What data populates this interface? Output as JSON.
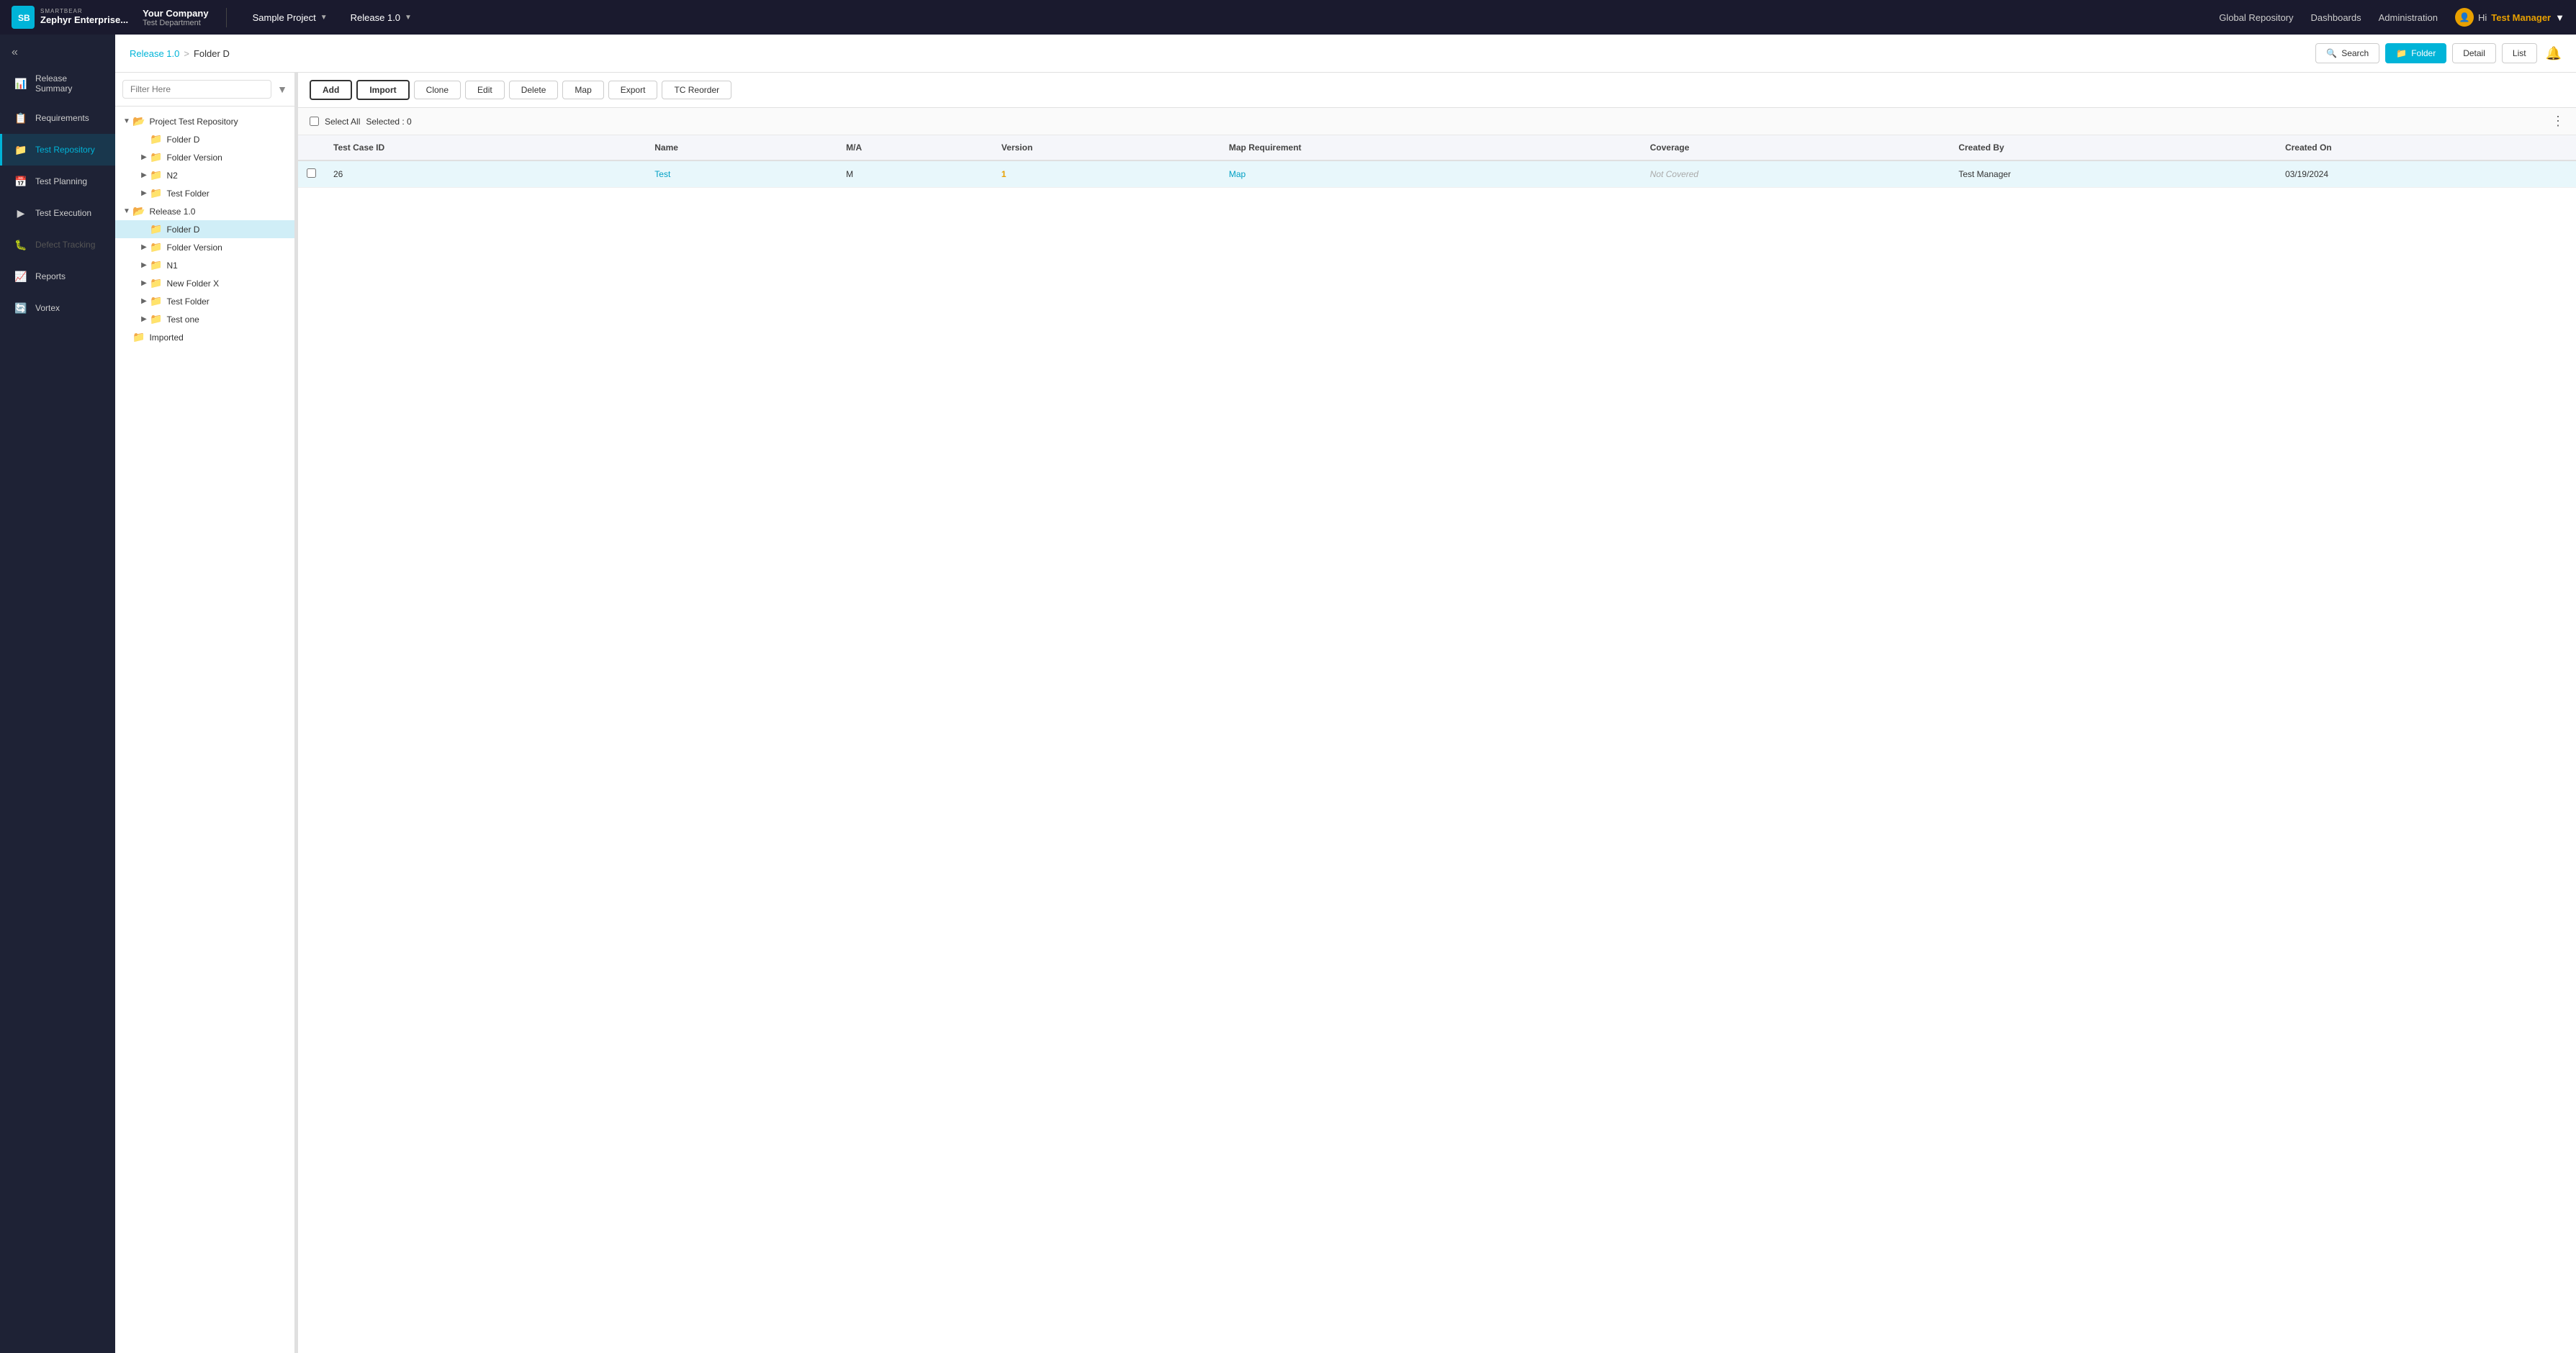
{
  "brand": {
    "logo_text": "SB",
    "top_text": "SMARTBEAR",
    "bottom_text": "Zephyr Enterprise..."
  },
  "company": {
    "name": "Your Company",
    "department": "Test Department"
  },
  "nav": {
    "project_label": "Sample Project",
    "release_label": "Release 1.0",
    "global_repo": "Global Repository",
    "dashboards": "Dashboards",
    "administration": "Administration",
    "hi_text": "Hi",
    "username": "Test Manager"
  },
  "sidebar": {
    "toggle_icon": "«",
    "items": [
      {
        "id": "release-summary",
        "label": "Release Summary",
        "icon": "📊"
      },
      {
        "id": "requirements",
        "label": "Requirements",
        "icon": "📋"
      },
      {
        "id": "test-repository",
        "label": "Test Repository",
        "icon": "📁",
        "active": true
      },
      {
        "id": "test-planning",
        "label": "Test Planning",
        "icon": "📅"
      },
      {
        "id": "test-execution",
        "label": "Test Execution",
        "icon": "▶"
      },
      {
        "id": "defect-tracking",
        "label": "Defect Tracking",
        "icon": "🐛",
        "disabled": true
      },
      {
        "id": "reports",
        "label": "Reports",
        "icon": "📈"
      },
      {
        "id": "vortex",
        "label": "Vortex",
        "icon": "🔄"
      }
    ]
  },
  "breadcrumb": {
    "parent": "Release 1.0",
    "separator": ">",
    "current": "Folder D"
  },
  "header_buttons": {
    "search": "Search",
    "folder": "Folder",
    "detail": "Detail",
    "list": "List"
  },
  "filter_placeholder": "Filter Here",
  "tree": {
    "sections": [
      {
        "label": "Project Test Repository",
        "expanded": true,
        "icon": "folder-open",
        "indent": 0,
        "children": [
          {
            "label": "Folder D",
            "indent": 1,
            "icon": "folder-closed"
          },
          {
            "label": "Folder Version",
            "indent": 1,
            "icon": "folder-closed",
            "has_toggle": true
          },
          {
            "label": "N2",
            "indent": 1,
            "icon": "folder-closed",
            "has_toggle": true
          },
          {
            "label": "Test Folder",
            "indent": 1,
            "icon": "folder-closed",
            "has_toggle": true
          }
        ]
      },
      {
        "label": "Release 1.0",
        "expanded": true,
        "icon": "folder-open",
        "indent": 0,
        "children": [
          {
            "label": "Folder D",
            "indent": 1,
            "icon": "folder-closed",
            "selected": true
          },
          {
            "label": "Folder Version",
            "indent": 1,
            "icon": "folder-closed",
            "has_toggle": true
          },
          {
            "label": "N1",
            "indent": 1,
            "icon": "folder-closed",
            "has_toggle": true
          },
          {
            "label": "New Folder X",
            "indent": 1,
            "icon": "folder-closed",
            "has_toggle": true
          },
          {
            "label": "Test Folder",
            "indent": 1,
            "icon": "folder-closed",
            "has_toggle": true
          },
          {
            "label": "Test one",
            "indent": 1,
            "icon": "folder-closed",
            "has_toggle": true
          }
        ]
      },
      {
        "label": "Imported",
        "expanded": false,
        "icon": "folder-closed",
        "indent": 0
      }
    ]
  },
  "toolbar_buttons": {
    "add": "Add",
    "import": "Import",
    "clone": "Clone",
    "edit": "Edit",
    "delete": "Delete",
    "map": "Map",
    "export": "Export",
    "tc_reorder": "TC Reorder"
  },
  "selection_bar": {
    "select_all": "Select All",
    "selected_count": "Selected : 0"
  },
  "table": {
    "columns": [
      "",
      "Test Case ID",
      "Name",
      "M/A",
      "Version",
      "Map Requirement",
      "Coverage",
      "Created By",
      "Created On"
    ],
    "rows": [
      {
        "id": "26",
        "name": "Test",
        "ma": "M",
        "version": "1",
        "map_requirement": "Map",
        "coverage": "Not Covered",
        "created_by": "Test Manager",
        "created_on": "03/19/2024"
      }
    ]
  }
}
